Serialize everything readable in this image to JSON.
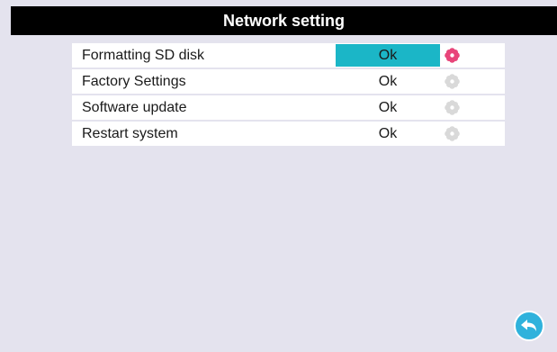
{
  "header": {
    "title": "Network setting"
  },
  "rows": [
    {
      "label": "Formatting SD disk",
      "button": "Ok",
      "selected": true,
      "icon": "flower-icon",
      "icon_color": "#e8457a"
    },
    {
      "label": "Factory Settings",
      "button": "Ok",
      "selected": false,
      "icon": "flower-icon",
      "icon_color": "#d9d9d9"
    },
    {
      "label": "Software update",
      "button": "Ok",
      "selected": false,
      "icon": "flower-icon",
      "icon_color": "#d9d9d9"
    },
    {
      "label": "Restart system",
      "button": "Ok",
      "selected": false,
      "icon": "flower-icon",
      "icon_color": "#d9d9d9"
    }
  ],
  "footer": {
    "back_icon": "back-arrow-icon"
  },
  "colors": {
    "background": "#e4e3ee",
    "title_bar": "#000000",
    "selection": "#1bb6c7",
    "back_button": "#2fb2dc"
  }
}
